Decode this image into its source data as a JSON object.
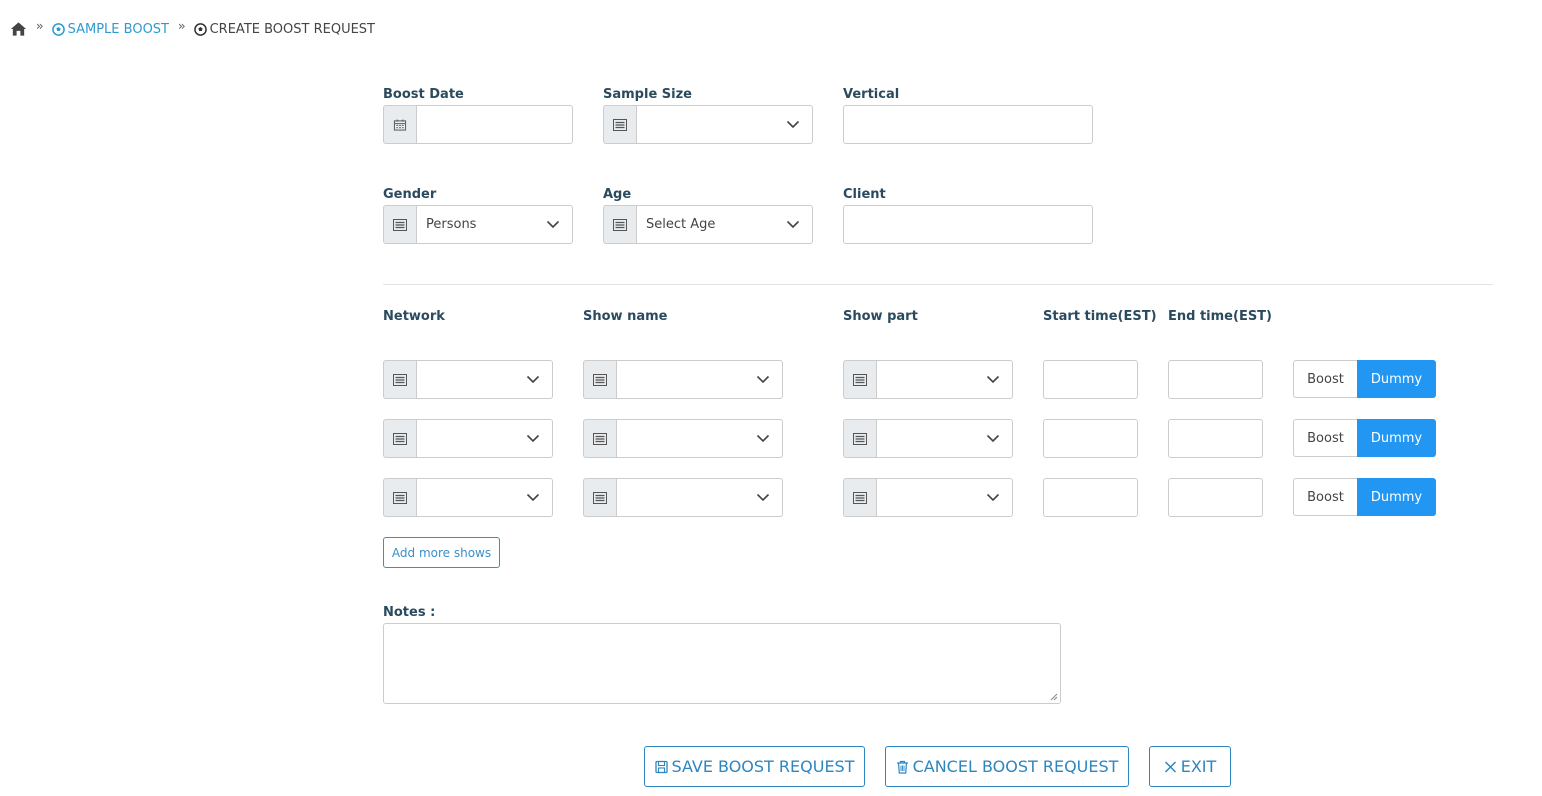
{
  "breadcrumb": {
    "home_icon": "home-icon",
    "items": [
      {
        "label": "SAMPLE BOOST",
        "icon": "soccer-ball-icon",
        "color": "#2e9ad0"
      },
      {
        "label": "CREATE BOOST REQUEST",
        "icon": "soccer-ball-icon",
        "color": "#444444"
      }
    ]
  },
  "form": {
    "boost_date": {
      "label": "Boost Date",
      "value": "",
      "icon": "calendar-icon"
    },
    "sample_size": {
      "label": "Sample Size",
      "value": "",
      "icon": "list-icon"
    },
    "vertical": {
      "label": "Vertical",
      "value": ""
    },
    "gender": {
      "label": "Gender",
      "value": "Persons",
      "icon": "list-icon"
    },
    "age": {
      "label": "Age",
      "value": "Select Age",
      "icon": "list-icon"
    },
    "client": {
      "label": "Client",
      "value": ""
    }
  },
  "shows": {
    "headers": {
      "network": "Network",
      "show_name": "Show name",
      "show_part": "Show part",
      "start_time": "Start time(EST)",
      "end_time": "End time(EST)"
    },
    "rows": [
      {
        "network": "",
        "show_name": "",
        "show_part": "",
        "start": "",
        "end": "",
        "boost_label": "Boost",
        "dummy_label": "Dummy",
        "selected": "Dummy"
      },
      {
        "network": "",
        "show_name": "",
        "show_part": "",
        "start": "",
        "end": "",
        "boost_label": "Boost",
        "dummy_label": "Dummy",
        "selected": "Dummy"
      },
      {
        "network": "",
        "show_name": "",
        "show_part": "",
        "start": "",
        "end": "",
        "boost_label": "Boost",
        "dummy_label": "Dummy",
        "selected": "Dummy"
      }
    ],
    "add_more_label": "Add more shows"
  },
  "notes": {
    "label": "Notes :",
    "value": ""
  },
  "actions": {
    "save": "SAVE BOOST REQUEST",
    "cancel": "CANCEL BOOST REQUEST",
    "exit": "EXIT"
  },
  "colors": {
    "accent": "#2196f3",
    "link": "#2e9ad0",
    "button_outline": "#2e86c1",
    "label": "#2a4a5e"
  }
}
